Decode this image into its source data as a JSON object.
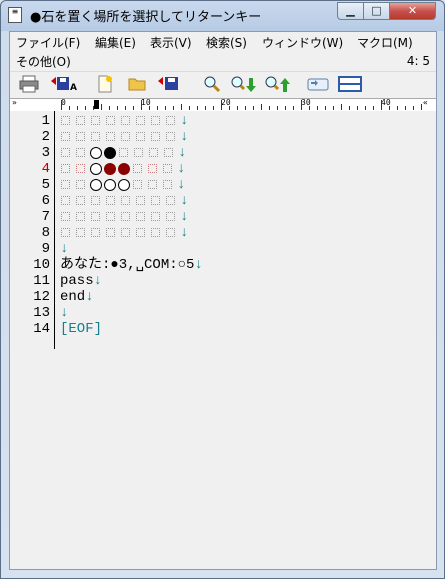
{
  "window": {
    "title": "●石を置く場所を選択してリターンキー",
    "icon": "text-file-icon",
    "buttons": {
      "min": "▁",
      "max": "□",
      "close": "✕"
    }
  },
  "menu": {
    "items": [
      "ファイル(F)",
      "編集(E)",
      "表示(V)",
      "検索(S)",
      "ウィンドウ(W)",
      "マクロ(M)",
      "その他(O)"
    ],
    "cursor_pos": "4: 5"
  },
  "toolbar": {
    "icons": [
      "print-icon",
      "save-as-icon",
      "new-icon",
      "open-icon",
      "save-icon",
      "search-icon",
      "search-next-icon",
      "search-prev-icon",
      "tag-jump-icon",
      "split-window-icon"
    ]
  },
  "ruler": {
    "labels": [
      "0",
      "10",
      "20",
      "30",
      "40"
    ],
    "left_marker": "»",
    "right_marker": "«"
  },
  "editor": {
    "line_numbers": [
      "1",
      "2",
      "3",
      "4",
      "5",
      "6",
      "7",
      "8",
      "9",
      "10",
      "11",
      "12",
      "13",
      "14"
    ],
    "current_line": "4",
    "board": [
      [
        "e",
        "e",
        "e",
        "e",
        "e",
        "e",
        "e",
        "e"
      ],
      [
        "e",
        "e",
        "e",
        "e",
        "e",
        "e",
        "e",
        "e"
      ],
      [
        "e",
        "e",
        "w",
        "b",
        "e",
        "e",
        "e",
        "e"
      ],
      [
        "e",
        "e",
        "w",
        "r",
        "r",
        "e",
        "e",
        "e"
      ],
      [
        "e",
        "e",
        "w",
        "w",
        "w",
        "e",
        "e",
        "e"
      ],
      [
        "e",
        "e",
        "e",
        "e",
        "e",
        "e",
        "e",
        "e"
      ],
      [
        "e",
        "e",
        "e",
        "e",
        "e",
        "e",
        "e",
        "e"
      ],
      [
        "e",
        "e",
        "e",
        "e",
        "e",
        "e",
        "e",
        "e"
      ]
    ],
    "newline_mark": "↓",
    "line10": "あなた:●3,␣COM:○5",
    "line11": "pass",
    "line12": "end",
    "line14": "[EOF]"
  },
  "colors": {
    "accent_red": "#8b0000",
    "newline": "#1a7f8a"
  }
}
